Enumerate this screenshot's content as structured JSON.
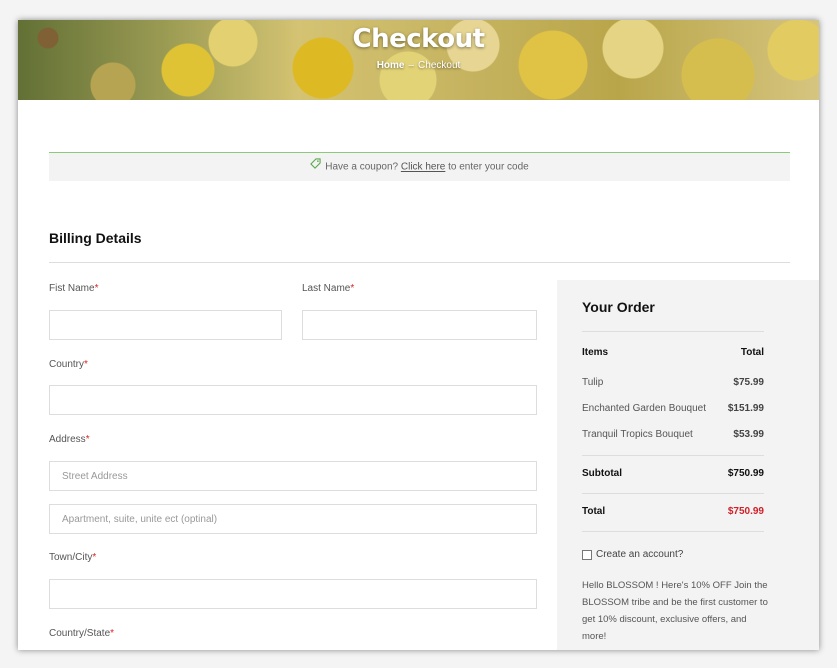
{
  "hero": {
    "title": "Checkout",
    "breadcrumb_home": "Home",
    "breadcrumb_sep": "–",
    "breadcrumb_current": "Checkout"
  },
  "coupon": {
    "prefix": "Have a coupon?",
    "link": "Click here",
    "suffix": "to enter your code"
  },
  "billing": {
    "title": "Billing Details",
    "required_mark": "*",
    "first_name_label": "Fist Name",
    "last_name_label": "Last Name",
    "country_label": "Country",
    "address_label": "Address",
    "street_placeholder": "Street Address",
    "apartment_placeholder": "Apartment, suite, unite ect (optinal)",
    "town_label": "Town/City",
    "state_label": "Country/State"
  },
  "order": {
    "title": "Your Order",
    "items_header": "Items",
    "total_header": "Total",
    "items": [
      {
        "name": "Tulip",
        "price": "$75.99"
      },
      {
        "name": "Enchanted Garden Bouquet",
        "price": "$151.99"
      },
      {
        "name": "Tranquil Tropics Bouquet",
        "price": "$53.99"
      }
    ],
    "subtotal_label": "Subtotal",
    "subtotal_value": "$750.99",
    "total_label": "Total",
    "total_value": "$750.99",
    "create_account_label": "Create an account?",
    "promo_text": "Hello BLOSSOM ! Here's 10% OFF Join the BLOSSOM tribe and be the first customer to get 10% discount, exclusive offers, and more!"
  },
  "colors": {
    "accent_total": "#d0202a",
    "required": "#dd2222",
    "coupon_border": "#8cc97a"
  },
  "icons": {
    "coupon": "tag-icon"
  }
}
